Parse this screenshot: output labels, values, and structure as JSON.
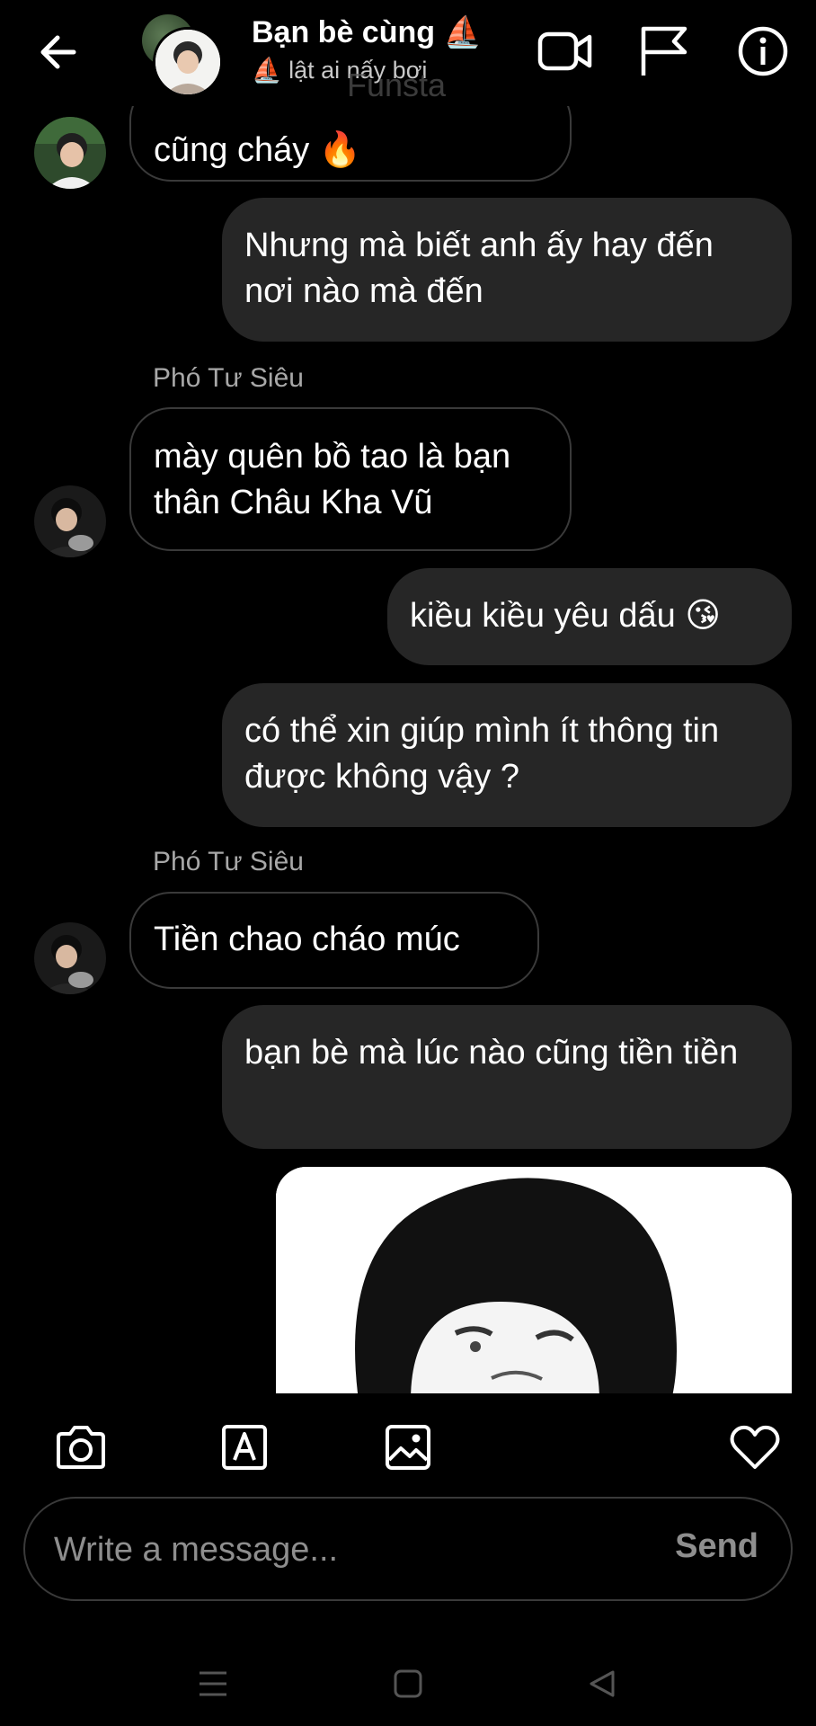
{
  "header": {
    "title": "Bạn bè cùng ⛵",
    "subtitle": "⛵ lật ai nấy bơi",
    "watermark": "Funsta",
    "back_icon": "arrow-left-icon",
    "video_icon": "video-camera-icon",
    "flag_icon": "flag-icon",
    "info_icon": "info-icon"
  },
  "messages": [
    {
      "type": "incoming",
      "text": "cũng cháy 🔥"
    },
    {
      "type": "outgoing",
      "text": "Nhưng mà biết anh ấy hay đến nơi nào mà đến"
    },
    {
      "type": "sender",
      "text": "Phó Tư Siêu"
    },
    {
      "type": "incoming",
      "text": "mày quên bồ tao là bạn thân Châu Kha Vũ"
    },
    {
      "type": "outgoing",
      "text": "kiều kiều yêu dấu 😘"
    },
    {
      "type": "outgoing",
      "text": "có thể xin giúp mình ít thông tin được không vậy ?"
    },
    {
      "type": "sender",
      "text": "Phó Tư Siêu"
    },
    {
      "type": "incoming",
      "text": "Tiền chao cháo múc"
    },
    {
      "type": "outgoing",
      "text": "bạn bè mà lúc nào cũng tiền tiền"
    },
    {
      "type": "outgoing-image",
      "text": ""
    }
  ],
  "toolbar": {
    "icons": [
      "camera-icon",
      "text-style-icon",
      "gallery-icon",
      "heart-icon"
    ]
  },
  "composer": {
    "placeholder": "Write a message...",
    "value": "",
    "send_label": "Send"
  },
  "navbar": {
    "icons": [
      "menu-icon",
      "home-icon",
      "back-triangle-icon"
    ]
  },
  "colors": {
    "background": "#000000",
    "outgoing_bubble": "#262626",
    "incoming_border": "#3a3a3a",
    "muted_text": "#a8a8a8"
  }
}
